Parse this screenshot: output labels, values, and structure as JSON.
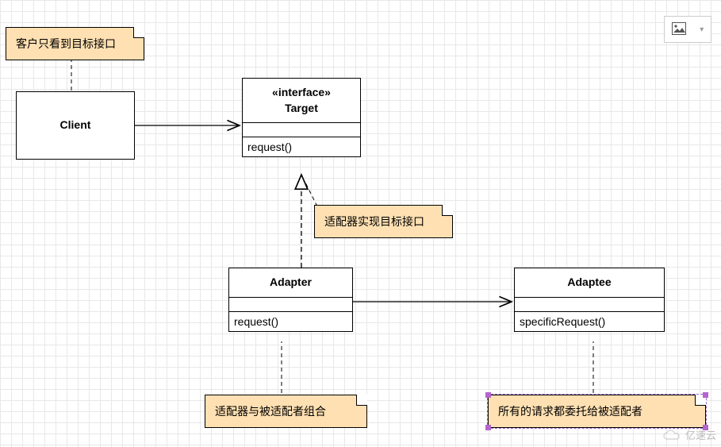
{
  "notes": {
    "client_note": "客户只看到目标接口",
    "adapter_impl_note": "适配器实现目标接口",
    "adapter_compose_note": "适配器与被适配者组合",
    "adaptee_delegate_note": "所有的请求都委托给被适配者"
  },
  "classes": {
    "client": {
      "name": "Client"
    },
    "target": {
      "stereotype": "«interface»",
      "name": "Target",
      "op": "request()"
    },
    "adapter": {
      "name": "Adapter",
      "op": "request()"
    },
    "adaptee": {
      "name": "Adaptee",
      "op": "specificRequest()"
    }
  },
  "toolbar": {
    "icon": "image-icon",
    "caret": "▾"
  },
  "watermark": "亿速云"
}
